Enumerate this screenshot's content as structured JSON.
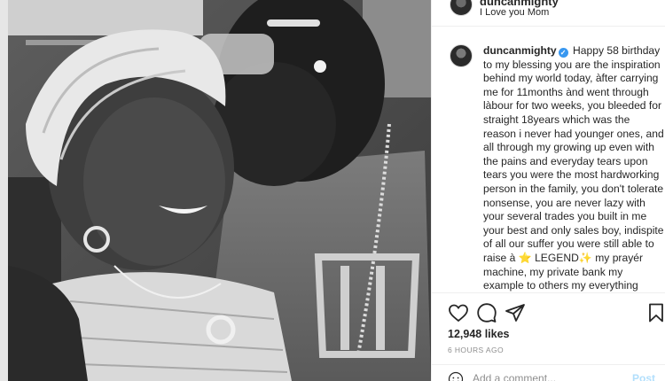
{
  "post": {
    "top_username": "duncanmighty",
    "top_caption": "I Love you Mom",
    "username": "duncanmighty",
    "verified": "✓",
    "caption": "Happy 58 birthday to my blessing you are the inspiration behind my world today, àfter carrying me for 11months ànd went through làbour for two weeks, you bleeded for straight 18years which was the reason i never had younger ones, and all through my growing up even with the pains and everyday tears upon tears you were the most hardworking person in the family, you don't tolerate nonsense, you are never lazy with your several trades you built in me your best and only sales boy, indispite of all our suffer you were still able to raise à ⭐ LEGEND✨ my prayér machine, my private bank my example to others my everything mummy i will continue to spoil you with more blessings and",
    "likes": "12,948 likes",
    "timestamp": "6 HOURS AGO"
  },
  "comment_box": {
    "placeholder": "Add a comment...",
    "post_label": "Post"
  },
  "icons": {
    "like": "heart-icon",
    "comment": "comment-icon",
    "share": "share-icon",
    "save": "bookmark-icon",
    "emoji": "smiley-icon"
  },
  "colors": {
    "text": "#262626",
    "secondary": "#8e8e8e",
    "verified": "#3897f0",
    "post_disabled": "#b2dffc",
    "border": "#efefef"
  }
}
